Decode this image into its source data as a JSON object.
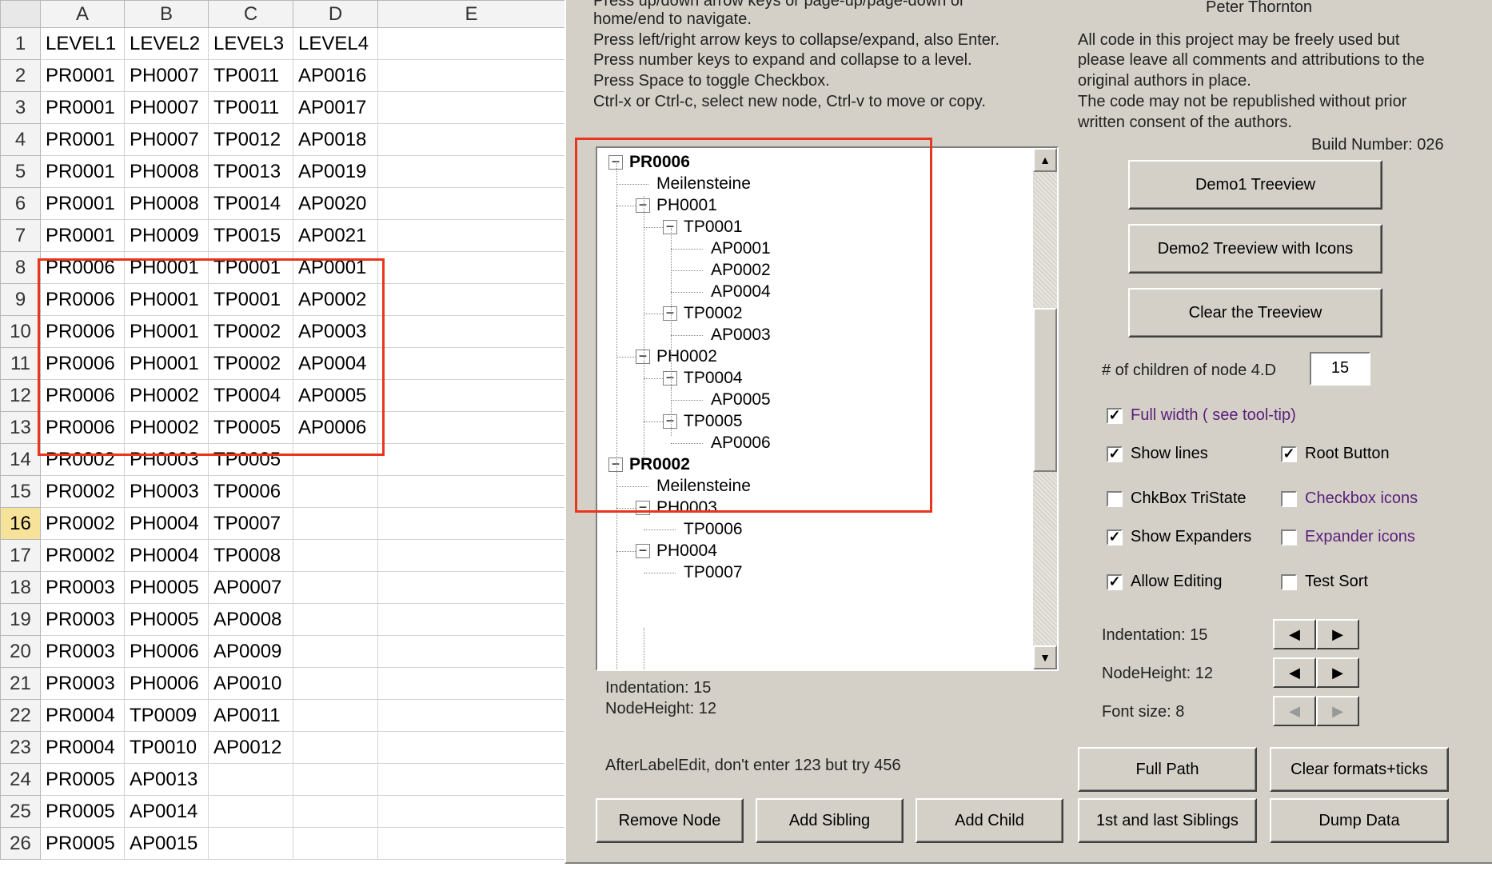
{
  "sheet": {
    "columns": [
      "A",
      "B",
      "C",
      "D",
      "E"
    ],
    "rows": [
      [
        "LEVEL1",
        "LEVEL2",
        "LEVEL3",
        "LEVEL4"
      ],
      [
        "PR0001",
        "PH0007",
        "TP0011",
        "AP0016"
      ],
      [
        "PR0001",
        "PH0007",
        "TP0011",
        "AP0017"
      ],
      [
        "PR0001",
        "PH0007",
        "TP0012",
        "AP0018"
      ],
      [
        "PR0001",
        "PH0008",
        "TP0013",
        "AP0019"
      ],
      [
        "PR0001",
        "PH0008",
        "TP0014",
        "AP0020"
      ],
      [
        "PR0001",
        "PH0009",
        "TP0015",
        "AP0021"
      ],
      [
        "PR0006",
        "PH0001",
        "TP0001",
        "AP0001"
      ],
      [
        "PR0006",
        "PH0001",
        "TP0001",
        "AP0002"
      ],
      [
        "PR0006",
        "PH0001",
        "TP0002",
        "AP0003"
      ],
      [
        "PR0006",
        "PH0001",
        "TP0002",
        "AP0004"
      ],
      [
        "PR0006",
        "PH0002",
        "TP0004",
        "AP0005"
      ],
      [
        "PR0006",
        "PH0002",
        "TP0005",
        "AP0006"
      ],
      [
        "PR0002",
        "PH0003",
        "TP0005",
        ""
      ],
      [
        "PR0002",
        "PH0003",
        "TP0006",
        ""
      ],
      [
        "PR0002",
        "PH0004",
        "TP0007",
        ""
      ],
      [
        "PR0002",
        "PH0004",
        "TP0008",
        ""
      ],
      [
        "PR0003",
        "PH0005",
        "AP0007",
        ""
      ],
      [
        "PR0003",
        "PH0005",
        "AP0008",
        ""
      ],
      [
        "PR0003",
        "PH0006",
        "AP0009",
        ""
      ],
      [
        "PR0003",
        "PH0006",
        "AP0010",
        ""
      ],
      [
        "PR0004",
        "TP0009",
        "AP0011",
        ""
      ],
      [
        "PR0004",
        "TP0010",
        "AP0012",
        ""
      ],
      [
        "PR0005",
        "AP0013",
        "",
        ""
      ],
      [
        "PR0005",
        "AP0014",
        "",
        ""
      ],
      [
        "PR0005",
        "AP0015",
        "",
        ""
      ]
    ],
    "active_row": 16
  },
  "form": {
    "help_lines": [
      "Press up/down arrow keys or page-up/page-down or",
      "home/end to navigate.",
      "Press left/right arrow keys to collapse/expand, also Enter.",
      "Press number keys to expand and collapse to a level.",
      "Press Space to toggle Checkbox.",
      "Ctrl-x or Ctrl-c, select new node, Ctrl-v to move or copy."
    ],
    "author": "Peter Thornton",
    "license_lines": [
      "All code in this project may be freely used but",
      "please leave all comments and attributions to the",
      "original authors in place.",
      "The code may not be republished without prior",
      "written consent of the authors."
    ],
    "build": "Build Number: 026",
    "tree_nodes": [
      {
        "label": "PR0006",
        "level": 0,
        "bold": true,
        "expander": "−"
      },
      {
        "label": "Meilensteine",
        "level": 1,
        "expander": ""
      },
      {
        "label": "PH0001",
        "level": 1,
        "expander": "−"
      },
      {
        "label": "TP0001",
        "level": 2,
        "expander": "−"
      },
      {
        "label": "AP0001",
        "level": 3,
        "expander": ""
      },
      {
        "label": "AP0002",
        "level": 3,
        "expander": ""
      },
      {
        "label": "AP0004",
        "level": 3,
        "expander": ""
      },
      {
        "label": "TP0002",
        "level": 2,
        "expander": "−"
      },
      {
        "label": "AP0003",
        "level": 3,
        "expander": ""
      },
      {
        "label": "PH0002",
        "level": 1,
        "expander": "−"
      },
      {
        "label": "TP0004",
        "level": 2,
        "expander": "−"
      },
      {
        "label": "AP0005",
        "level": 3,
        "expander": ""
      },
      {
        "label": "TP0005",
        "level": 2,
        "expander": "−"
      },
      {
        "label": "AP0006",
        "level": 3,
        "expander": ""
      },
      {
        "label": "PR0002",
        "level": 0,
        "bold": true,
        "expander": "−"
      },
      {
        "label": "Meilensteine",
        "level": 1,
        "expander": ""
      },
      {
        "label": "PH0003",
        "level": 1,
        "expander": "−"
      },
      {
        "label": "TP0006",
        "level": 2,
        "expander": ""
      },
      {
        "label": "PH0004",
        "level": 1,
        "expander": "−"
      },
      {
        "label": "TP0007",
        "level": 2,
        "expander": ""
      }
    ],
    "indentation_label": "Indentation:  15",
    "nodeheight_label": "NodeHeight:   12",
    "after_label_edit": "AfterLabelEdit, don't enter 123 but try 456",
    "buttons": {
      "demo1": "Demo1 Treeview",
      "demo2": "Demo2 Treeview with Icons",
      "clear": "Clear the Treeview",
      "full_path": "Full Path",
      "clear_formats": "Clear formats+ticks",
      "remove_node": "Remove Node",
      "add_sibling": "Add Sibling",
      "add_child": "Add Child",
      "first_last": "1st and last Siblings",
      "dump_data": "Dump Data"
    },
    "children_label": "# of children of node 4.D",
    "children_value": "15",
    "checkboxes": {
      "full_width": {
        "label": "Full width ( see tool-tip)",
        "checked": true
      },
      "show_lines": {
        "label": "Show lines",
        "checked": true
      },
      "root_button": {
        "label": "Root Button",
        "checked": true
      },
      "chkbox_tristate": {
        "label": "ChkBox TriState",
        "checked": false
      },
      "checkbox_icons": {
        "label": "Checkbox icons",
        "checked": false
      },
      "show_expanders": {
        "label": "Show Expanders",
        "checked": true
      },
      "expander_icons": {
        "label": "Expander icons",
        "checked": false
      },
      "allow_editing": {
        "label": "Allow Editing",
        "checked": true
      },
      "test_sort": {
        "label": "Test Sort",
        "checked": false
      }
    },
    "indentation_ctrl": "Indentation: 15",
    "nodeheight_ctrl": "NodeHeight: 12",
    "fontsize_ctrl": "Font size:   8",
    "arrow_left": "◀",
    "arrow_right": "▶",
    "scroll_up": "▲",
    "scroll_down": "▼",
    "check_mark": "✓"
  },
  "colors": {
    "highlight_box": "#e8361c",
    "dialog_bg": "#d4d0c8",
    "purple_label": "#5a1f7a"
  }
}
